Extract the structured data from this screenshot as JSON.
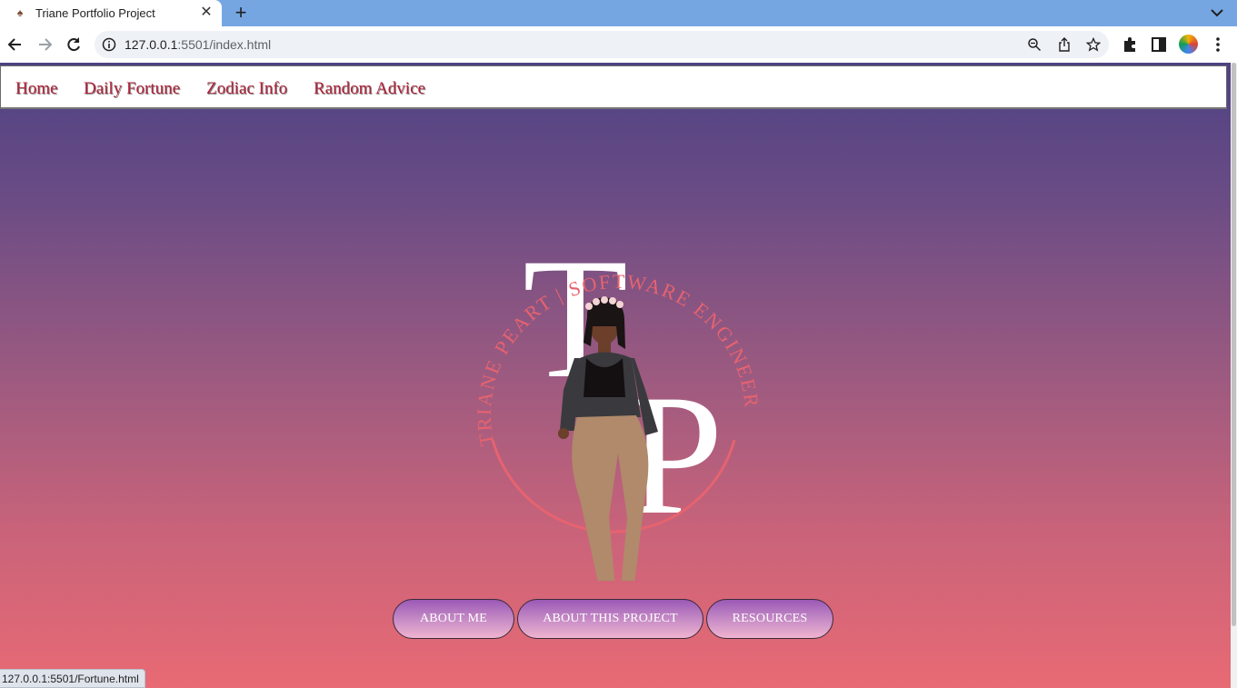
{
  "browser": {
    "tab_title": "Triane Portfolio Project",
    "url_host": "127.0.0.1",
    "url_path": ":5501/index.html",
    "status_url": "127.0.0.1:5501/Fortune.html"
  },
  "nav": {
    "items": [
      {
        "label": "Home"
      },
      {
        "label": "Daily Fortune"
      },
      {
        "label": "Zodiac Info"
      },
      {
        "label": "Random Advice"
      }
    ]
  },
  "logo": {
    "monogram_t": "T",
    "monogram_p": "P",
    "ring_text": "TRIANE PEART | SOFTWARE ENGINEER"
  },
  "buttons": {
    "about_me": "ABOUT ME",
    "about_project": "ABOUT THIS PROJECT",
    "resources": "RESOURCES"
  },
  "colors": {
    "gradient_top": "#4e4283",
    "gradient_bottom": "#e86a74",
    "nav_link": "#b0223a",
    "ring": "#e6636f"
  },
  "icons": [
    "back-icon",
    "forward-icon",
    "reload-icon",
    "info-icon",
    "zoom-icon",
    "share-icon",
    "star-icon",
    "extensions-icon",
    "side-panel-icon",
    "menu-icon"
  ]
}
